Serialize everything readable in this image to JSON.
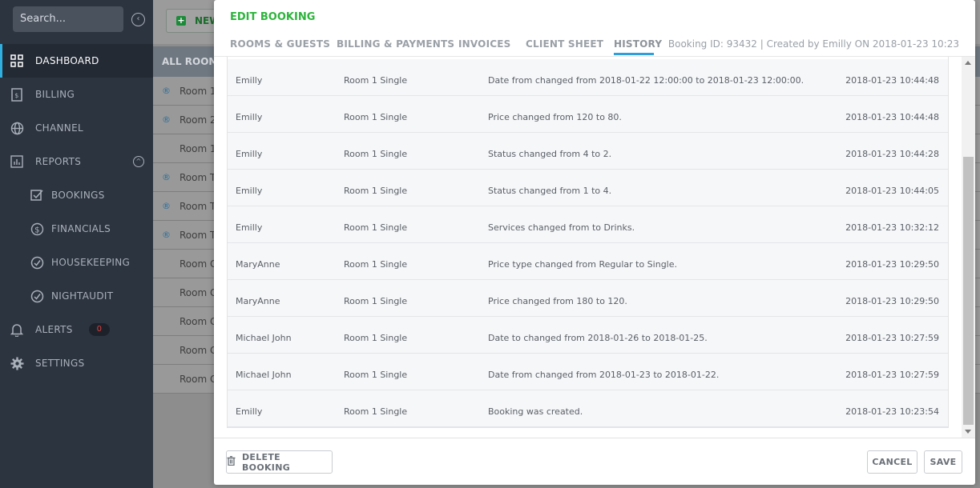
{
  "sidebar": {
    "search_placeholder": "Search...",
    "items": [
      {
        "label": "DASHBOARD",
        "icon": "grid-icon"
      },
      {
        "label": "BILLING",
        "icon": "invoice-icon"
      },
      {
        "label": "CHANNEL",
        "icon": "globe-icon"
      },
      {
        "label": "REPORTS",
        "icon": "bar-chart-icon"
      },
      {
        "label": "BOOKINGS",
        "icon": "checkbox-icon"
      },
      {
        "label": "FINANCIALS",
        "icon": "dollar-icon"
      },
      {
        "label": "HOUSEKEEPING",
        "icon": "check-circle-icon"
      },
      {
        "label": "NIGHTAUDIT",
        "icon": "check-circle-icon"
      },
      {
        "label": "ALERTS",
        "icon": "bell-icon"
      },
      {
        "label": "SETTINGS",
        "icon": "gear-icon"
      }
    ],
    "alerts_count": "0"
  },
  "background": {
    "new_button": "NEW",
    "rooms_header": "ALL ROOMS",
    "rows": [
      "Room 1",
      "Room 2",
      "Room 1",
      "Room T",
      "Room T",
      "Room T",
      "Room G",
      "Room G",
      "Room G",
      "Room G",
      "Room G"
    ]
  },
  "modal": {
    "title": "EDIT BOOKING",
    "tabs": [
      "ROOMS & GUESTS",
      "BILLING & PAYMENTS",
      "INVOICES",
      "CLIENT SHEET",
      "HISTORY"
    ],
    "active_tab": "HISTORY",
    "booking_info": "Booking ID: 93432 | Created by Emilly ON 2018-01-23 10:23",
    "history": [
      {
        "user": "Emilly",
        "room": "Room 1 Single",
        "change": "Date from changed from 2018-01-22 12:00:00 to 2018-01-23 12:00:00.",
        "time": "2018-01-23 10:44:48"
      },
      {
        "user": "Emilly",
        "room": "Room 1 Single",
        "change": "Price changed from 120 to 80.",
        "time": "2018-01-23 10:44:48"
      },
      {
        "user": "Emilly",
        "room": "Room 1 Single",
        "change": "Status changed from 4 to 2.",
        "time": "2018-01-23 10:44:28"
      },
      {
        "user": "Emilly",
        "room": "Room 1 Single",
        "change": "Status changed from 1 to 4.",
        "time": "2018-01-23 10:44:05"
      },
      {
        "user": "Emilly",
        "room": "Room 1 Single",
        "change": "Services changed from to Drinks.",
        "time": "2018-01-23 10:32:12"
      },
      {
        "user": "MaryAnne",
        "room": "Room 1 Single",
        "change": "Price type changed from Regular to Single.",
        "time": "2018-01-23 10:29:50"
      },
      {
        "user": "MaryAnne",
        "room": "Room 1 Single",
        "change": "Price changed from 180 to 120.",
        "time": "2018-01-23 10:29:50"
      },
      {
        "user": "Michael John",
        "room": "Room 1 Single",
        "change": "Date to changed from 2018-01-26 to 2018-01-25.",
        "time": "2018-01-23 10:27:59"
      },
      {
        "user": "Michael John",
        "room": "Room 1 Single",
        "change": "Date from changed from 2018-01-23 to 2018-01-22.",
        "time": "2018-01-23 10:27:59"
      },
      {
        "user": "Emilly",
        "room": "Room 1 Single",
        "change": "Booking was created.",
        "time": "2018-01-23 10:23:54"
      }
    ],
    "footer": {
      "delete_label": "DELETE BOOKING",
      "cancel_label": "CANCEL",
      "save_label": "SAVE"
    }
  },
  "colors": {
    "title_green": "#2db43c",
    "tab_underline": "#2fa0db",
    "sidebar_bg": "#2c3440",
    "alert_badge_text": "#e04040"
  }
}
